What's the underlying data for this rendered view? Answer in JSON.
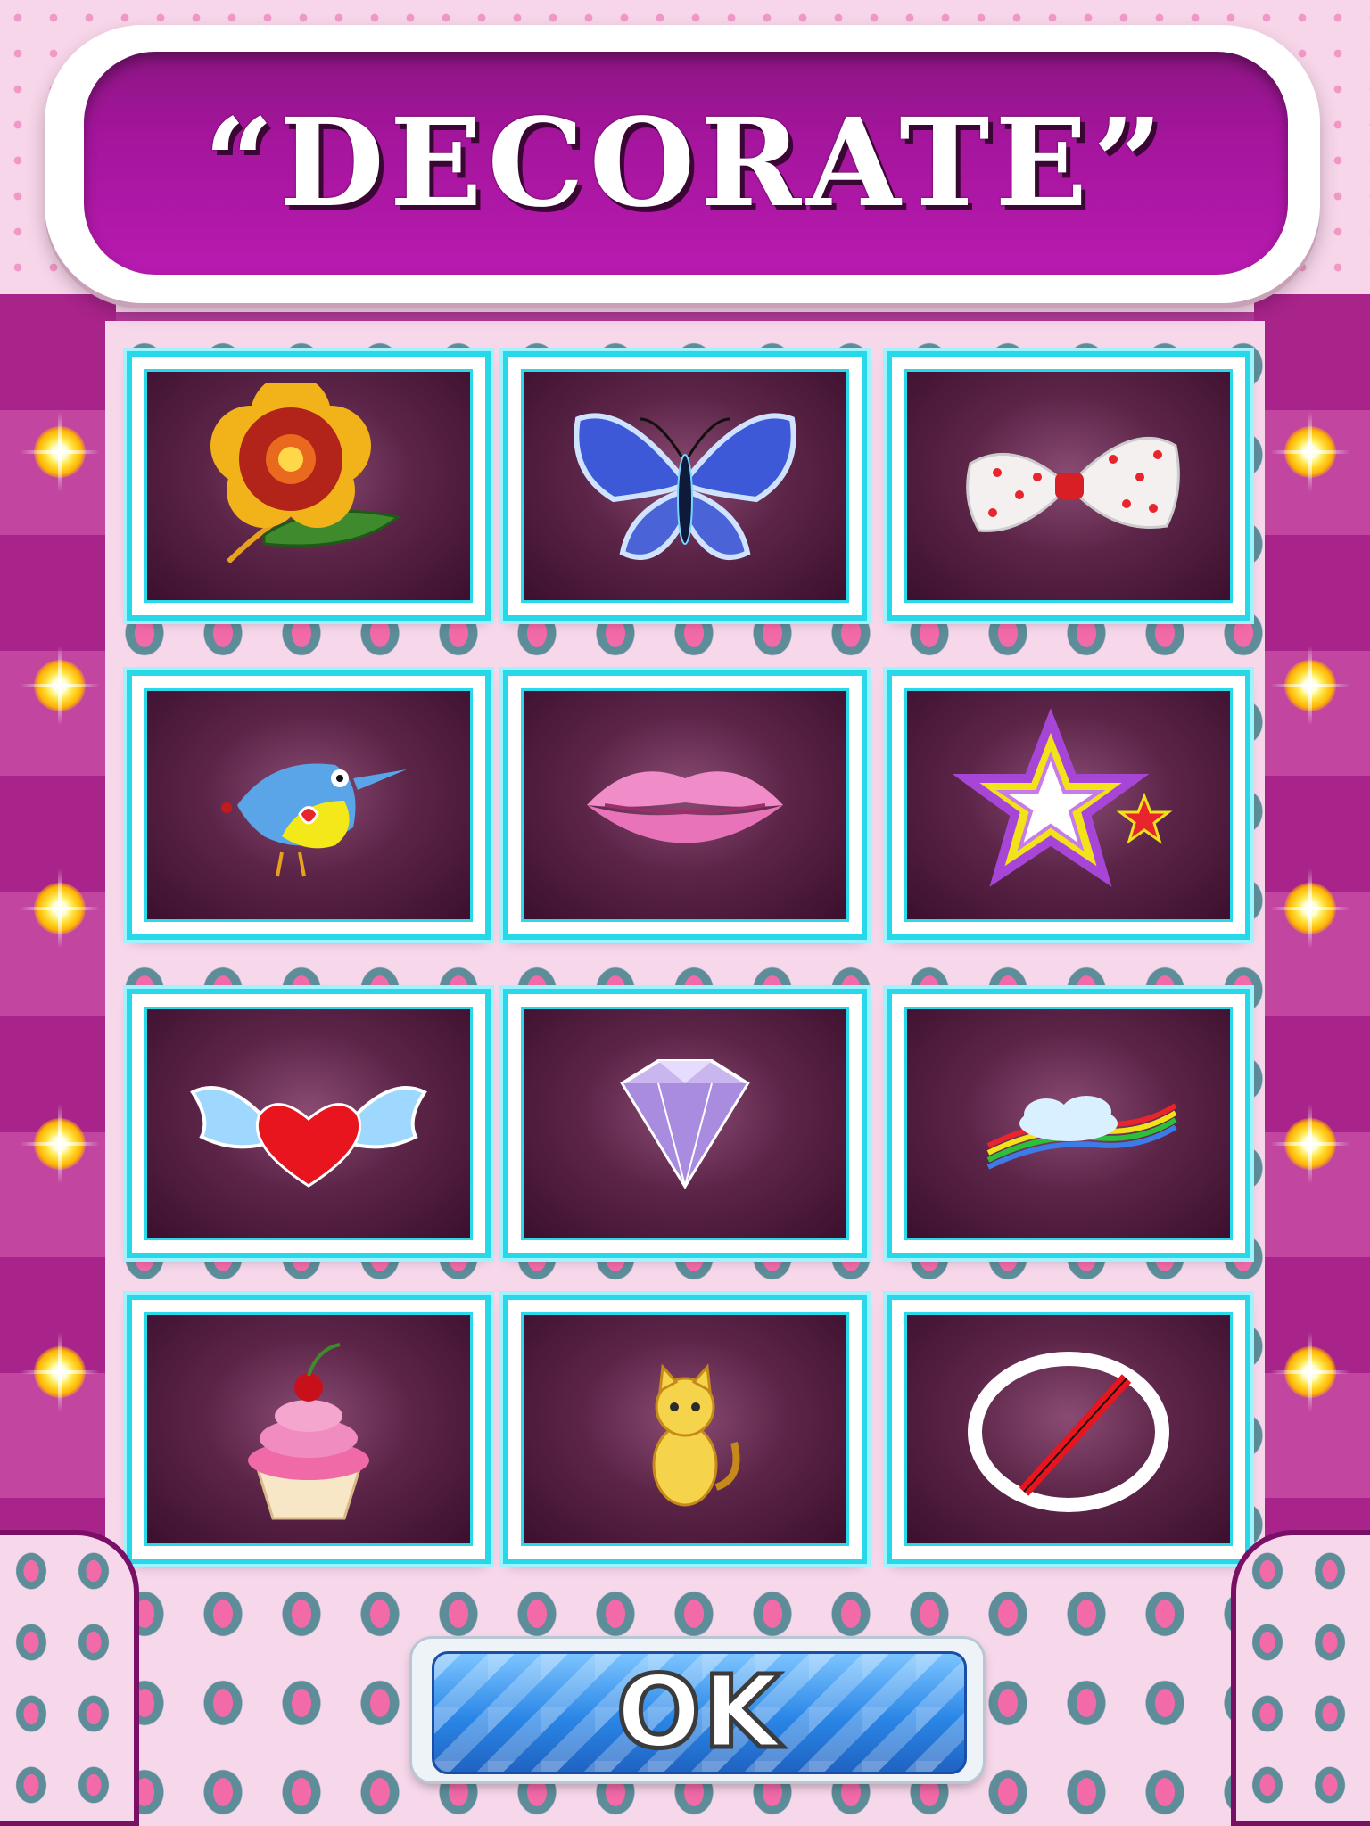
{
  "header": {
    "title": "“DECORATE”"
  },
  "decorations": [
    {
      "name": "flower-icon"
    },
    {
      "name": "butterfly-icon"
    },
    {
      "name": "polka-dot-bow-icon"
    },
    {
      "name": "bird-icon"
    },
    {
      "name": "lips-icon"
    },
    {
      "name": "stars-icon"
    },
    {
      "name": "winged-heart-icon"
    },
    {
      "name": "diamond-icon"
    },
    {
      "name": "rainbow-cloud-icon"
    },
    {
      "name": "cupcake-icon"
    },
    {
      "name": "kitten-icon"
    },
    {
      "name": "none-icon"
    }
  ],
  "footer": {
    "ok_label": "OK"
  },
  "colors": {
    "tile_border": "#26d8e8",
    "title_bg": "#a5159d",
    "ok_button": "#2a86e6"
  }
}
